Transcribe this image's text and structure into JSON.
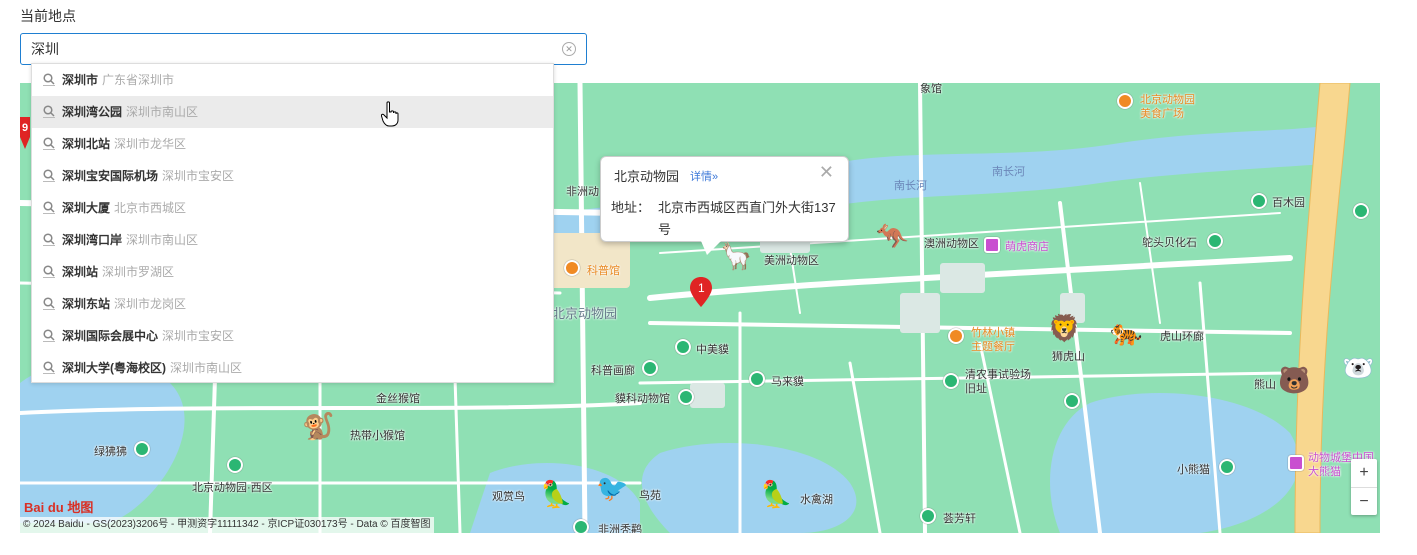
{
  "form": {
    "label": "当前地点",
    "search_value": "深圳"
  },
  "suggestions": [
    {
      "name": "深圳市",
      "region": "广东省深圳市"
    },
    {
      "name": "深圳湾公园",
      "region": "深圳市南山区"
    },
    {
      "name": "深圳北站",
      "region": "深圳市龙华区"
    },
    {
      "name": "深圳宝安国际机场",
      "region": "深圳市宝安区"
    },
    {
      "name": "深圳大厦",
      "region": "北京市西城区"
    },
    {
      "name": "深圳湾口岸",
      "region": "深圳市南山区"
    },
    {
      "name": "深圳站",
      "region": "深圳市罗湖区"
    },
    {
      "name": "深圳东站",
      "region": "深圳市龙岗区"
    },
    {
      "name": "深圳国际会展中心",
      "region": "深圳市宝安区"
    },
    {
      "name": "深圳大学(粤海校区)",
      "region": "深圳市南山区"
    }
  ],
  "info_window": {
    "title": "北京动物园",
    "detail_link": "详情»",
    "close": "✕",
    "address_label": "地址：",
    "address": "北京市西城区西直门外大街137号"
  },
  "marker": {
    "number": "1"
  },
  "edge_marker": {
    "number": "9"
  },
  "map_labels": {
    "zoo_food_plaza_1": "北京动物园",
    "zoo_food_plaza_2": "美食广场",
    "nanchang_river_1": "南长河",
    "nanchang_river_2": "南长河",
    "africa_area": "非洲动",
    "baimu_garden": "百木园",
    "australia_area": "澳洲动物区",
    "menghu_shop": "萌虎商店",
    "ostrich_fossil": "鸵头贝化石",
    "americas_area": "美洲动物区",
    "science_hall": "科普馆",
    "beijing_zoo": "北京动物园",
    "bamboo_town_1": "竹林小镇",
    "bamboo_town_2": "主题餐厅",
    "lion_tiger_hill": "狮虎山",
    "tiger_gallery": "虎山环廊",
    "zhongmei_house": "中美貘",
    "science_gallery": "科普画廊",
    "malay_tapir": "马来貘",
    "qingnong_1": "清农事试验场",
    "qingnong_2": "旧址",
    "bear_hill": "熊山",
    "tapir_hall": "貘科动物馆",
    "golden_monkey": "金丝猴馆",
    "tropical_monkey": "热带小猴馆",
    "green_gibbon": "绿狒狒",
    "west_zoo": "北京动物园·西区",
    "bird_watch": "观赏鸟",
    "bird_garden": "鸟苑",
    "waterfowl_lake": "水禽湖",
    "red_panda": "小熊猫",
    "zoo_city_1": "动物城堡中国",
    "zoo_city_2": "大熊猫",
    "zoo_city_3": "国际",
    "huifang": "荟芳轩",
    "africa_birds": "非洲秃鹳",
    "jiaxiang": "象馆"
  },
  "zoom": {
    "in": "+",
    "out": "−"
  },
  "branding": {
    "logo": "Bai du 地图",
    "copyright": "© 2024 Baidu - GS(2023)3206号 - 甲测资字11111342 - 京ICP证030173号 - Data © 百度智图"
  },
  "colors": {
    "land": "#8fe0b4",
    "water": "#9fd2f0",
    "road": "#ffffff",
    "highway": "#f8d78f",
    "accent": "#1f7fd1",
    "marker": "#e02424"
  }
}
